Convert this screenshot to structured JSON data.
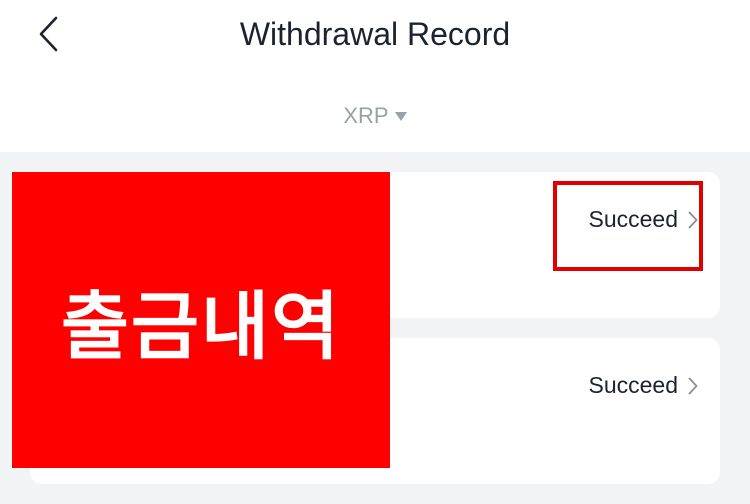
{
  "header": {
    "title": "Withdrawal Record",
    "back_icon": "chevron-left-icon",
    "coin_filter": {
      "selected": "XRP",
      "icon": "caret-down-icon"
    }
  },
  "records": [
    {
      "status": "Succeed"
    },
    {
      "status": "Succeed"
    }
  ],
  "annotation": {
    "overlay_text": "출금내역",
    "overlay_color": "#ff0000",
    "highlight_color": "#e00000"
  }
}
